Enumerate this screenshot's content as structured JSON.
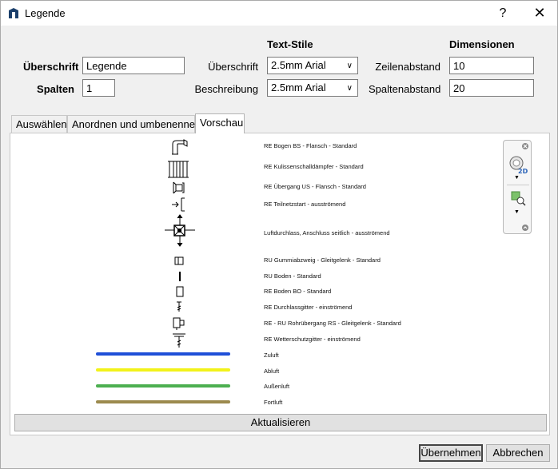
{
  "window": {
    "title": "Legende",
    "help": "?",
    "close": "✕"
  },
  "form": {
    "heading_label": "Überschrift",
    "heading_value": "Legende",
    "columns_label": "Spalten",
    "columns_value": "1"
  },
  "text_styles": {
    "header": "Text-Stile",
    "heading_label": "Überschrift",
    "heading_value": "2.5mm Arial",
    "description_label": "Beschreibung",
    "description_value": "2.5mm Arial"
  },
  "dimensions": {
    "header": "Dimensionen",
    "row_spacing_label": "Zeilenabstand",
    "row_spacing_value": "10",
    "col_spacing_label": "Spaltenabstand",
    "col_spacing_value": "20"
  },
  "tabs": [
    {
      "label": "Auswählen"
    },
    {
      "label": "Anordnen und umbenennen"
    },
    {
      "label": "Vorschau"
    }
  ],
  "legend": [
    {
      "label": "RE Bogen BS - Flansch - Standard"
    },
    {
      "label": "RE Kulissenschalldämpfer - Standard"
    },
    {
      "label": "RE Übergang US - Flansch - Standard"
    },
    {
      "label": "RE Teilnetzstart - ausströmend"
    },
    {
      "label": "Luftdurchlass, Anschluss seitlich - ausströmend"
    },
    {
      "label": "RU Gummiabzweig - Gleitgelenk - Standard"
    },
    {
      "label": "RU Boden - Standard"
    },
    {
      "label": "RE Boden BO - Standard"
    },
    {
      "label": "RE Durchlassgitter - einströmend"
    },
    {
      "label": "RE - RU Rohrübergang RS - Gleitgelenk - Standard"
    },
    {
      "label": "RE Wetterschutzgitter - einströmend"
    },
    {
      "label": "Zuluft",
      "color": "#1f4fd8"
    },
    {
      "label": "Abluft",
      "color": "#f2f21a"
    },
    {
      "label": "Außenluft",
      "color": "#4caf50"
    },
    {
      "label": "Fortluft",
      "color": "#9c8a4e"
    }
  ],
  "nav_widget": {
    "icons": [
      "close-icon",
      "view-2d-icon",
      "zoom-extents-icon"
    ]
  },
  "buttons": {
    "refresh": "Aktualisieren",
    "apply": "Übernehmen",
    "cancel": "Abbrechen"
  }
}
